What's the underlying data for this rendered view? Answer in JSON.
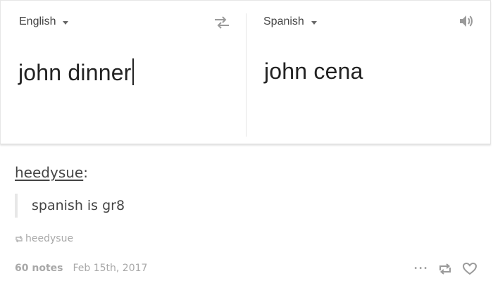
{
  "translator": {
    "source_language": "English",
    "target_language": "Spanish",
    "source_text": "john dinner",
    "translated_text": "john cena"
  },
  "post": {
    "username": "heedysue",
    "username_suffix": ":",
    "quote_text": "spanish is gr8",
    "reblog_user": "heedysue",
    "notes": "60 notes",
    "date": "Feb 15th, 2017",
    "more_label": "•••"
  },
  "colors": {
    "text_dark": "#222222",
    "text_mid": "#444444",
    "text_muted": "#a8a8a8",
    "border": "#e6e6e6"
  }
}
